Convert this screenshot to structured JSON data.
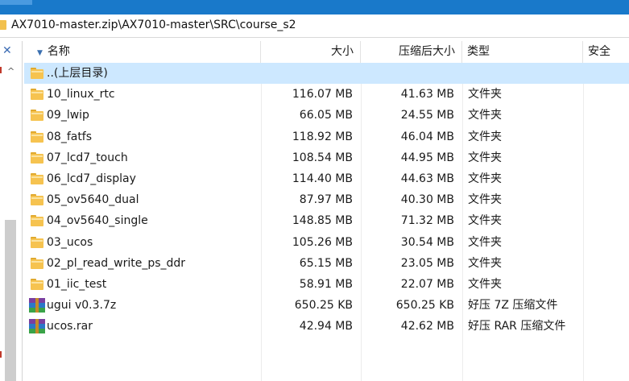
{
  "address": {
    "path": "AX7010-master.zip\\AX7010-master\\SRC\\course_s2"
  },
  "columns": {
    "name": "名称",
    "size": "大小",
    "compressed": "压缩后大小",
    "type": "类型",
    "security": "安全"
  },
  "gutter": {
    "close": "✕",
    "up": "^"
  },
  "rows": [
    {
      "name": "..(上层目录)",
      "size": "",
      "compressed": "",
      "type": "",
      "icon": "folder-icon",
      "selected": true
    },
    {
      "name": "10_linux_rtc",
      "size": "116.07 MB",
      "compressed": "41.63 MB",
      "type": "文件夹",
      "icon": "folder-icon"
    },
    {
      "name": "09_lwip",
      "size": "66.05 MB",
      "compressed": "24.55 MB",
      "type": "文件夹",
      "icon": "folder-icon"
    },
    {
      "name": "08_fatfs",
      "size": "118.92 MB",
      "compressed": "46.04 MB",
      "type": "文件夹",
      "icon": "folder-icon"
    },
    {
      "name": "07_lcd7_touch",
      "size": "108.54 MB",
      "compressed": "44.95 MB",
      "type": "文件夹",
      "icon": "folder-icon"
    },
    {
      "name": "06_lcd7_display",
      "size": "114.40 MB",
      "compressed": "44.63 MB",
      "type": "文件夹",
      "icon": "folder-icon"
    },
    {
      "name": "05_ov5640_dual",
      "size": "87.97 MB",
      "compressed": "40.30 MB",
      "type": "文件夹",
      "icon": "folder-icon"
    },
    {
      "name": "04_ov5640_single",
      "size": "148.85 MB",
      "compressed": "71.32 MB",
      "type": "文件夹",
      "icon": "folder-icon"
    },
    {
      "name": "03_ucos",
      "size": "105.26 MB",
      "compressed": "30.54 MB",
      "type": "文件夹",
      "icon": "folder-icon"
    },
    {
      "name": "02_pl_read_write_ps_ddr",
      "size": "65.15 MB",
      "compressed": "23.05 MB",
      "type": "文件夹",
      "icon": "folder-icon"
    },
    {
      "name": "01_iic_test",
      "size": "58.91 MB",
      "compressed": "22.07 MB",
      "type": "文件夹",
      "icon": "folder-icon"
    },
    {
      "name": "ugui v0.3.7z",
      "size": "650.25 KB",
      "compressed": "650.25 KB",
      "type": "好压 7Z 压缩文件",
      "icon": "archive-icon"
    },
    {
      "name": "ucos.rar",
      "size": "42.94 MB",
      "compressed": "42.62 MB",
      "type": "好压 RAR 压缩文件",
      "icon": "archive-icon"
    }
  ]
}
